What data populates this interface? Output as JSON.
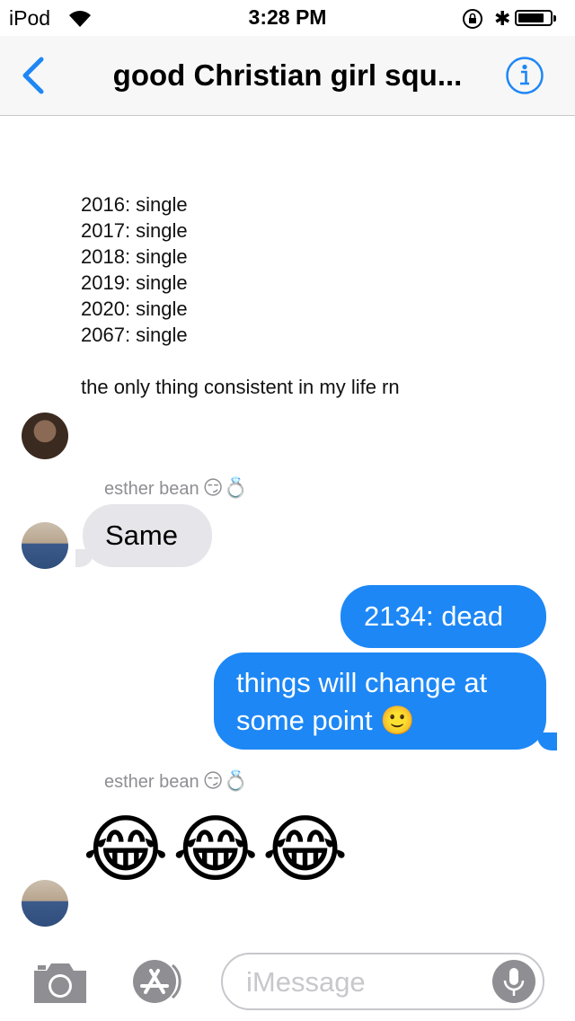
{
  "status_bar": {
    "carrier": "iPod",
    "time": "3:28 PM"
  },
  "nav": {
    "title": "good Christian girl squ...",
    "back_icon": "chevron-left-icon",
    "info_icon": "info-icon"
  },
  "shared_image": {
    "lines": [
      "2016: single",
      "2017: single",
      "2018: single",
      "2019: single",
      "2020: single",
      "2067: single",
      "the only thing consistent in my life rn"
    ]
  },
  "messages": [
    {
      "sender": "esther bean",
      "sender_emoji": "😏💍",
      "text": "Same",
      "direction": "incoming"
    },
    {
      "text": "2134: dead",
      "direction": "outgoing"
    },
    {
      "text_line1": "things will change at",
      "text_line2": "some point 🙂",
      "direction": "outgoing"
    },
    {
      "sender": "esther bean",
      "sender_emoji": "😏💍",
      "text": "😂😂😂",
      "direction": "incoming"
    }
  ],
  "input_bar": {
    "placeholder": "iMessage"
  },
  "colors": {
    "accent": "#1d87f5",
    "incoming_bubble": "#e5e5ea",
    "outgoing_bubble": "#1d87f5"
  }
}
